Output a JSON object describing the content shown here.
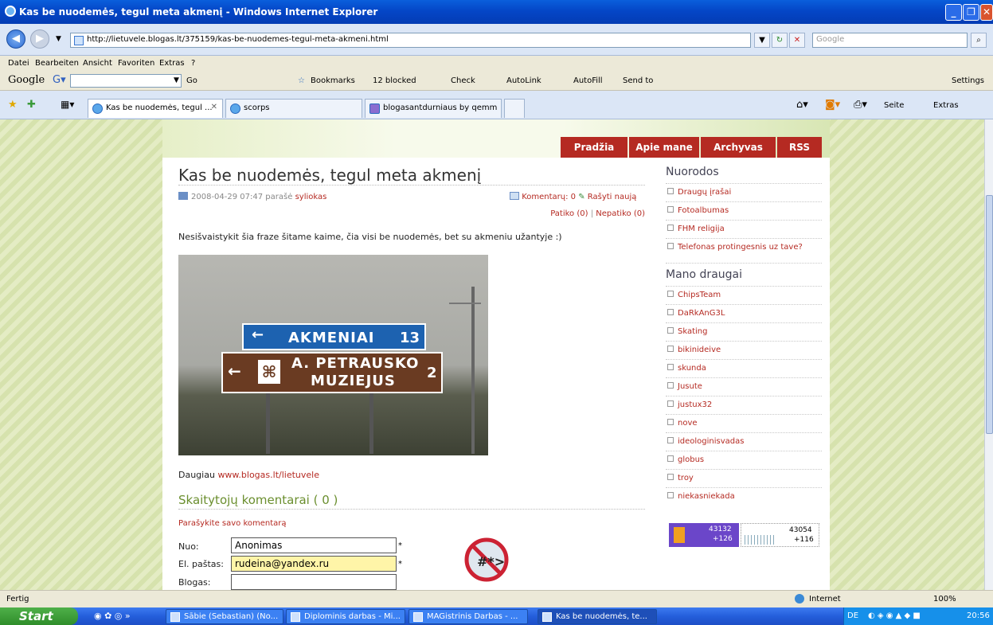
{
  "window": {
    "title": "Kas be nuodemės, tegul meta akmenį - Windows Internet Explorer"
  },
  "address": {
    "url": "http://lietuvele.blogas.lt/375159/kas-be-nuodemes-tegul-meta-akmeni.html",
    "search_placeholder": "Google"
  },
  "menu": [
    "Datei",
    "Bearbeiten",
    "Ansicht",
    "Favoriten",
    "Extras",
    "?"
  ],
  "google_toolbar": {
    "brand": "Google",
    "go": "Go",
    "bookmarks": "Bookmarks",
    "blocked": "12 blocked",
    "check": "Check",
    "autolink": "AutoLink",
    "autofill": "AutoFill",
    "sendto": "Send to",
    "settings": "Settings"
  },
  "tabs": [
    "Kas be nuodemės, tegul ...",
    "scorps",
    "blogasantdurniaus by qemm"
  ],
  "cmdbar": {
    "seite": "Seite",
    "extras": "Extras"
  },
  "blog": {
    "nav": [
      "Pradžia",
      "Apie mane",
      "Archyvas",
      "RSS"
    ],
    "post_title": "Kas be nuodemės, tegul meta akmenį",
    "meta_date": "2008-04-29 07:47 parašė",
    "meta_author": "syliokas",
    "comments_link": "Komentarų: 0",
    "write_new": "Rašyti naują",
    "likes": "Patiko (0)",
    "sep": "|",
    "dislikes": "Nepatiko (0)",
    "body": "Nesišvaistykit šia fraze šitame kaime, čia visi be nuodemės, bet su akmeniu užantyje :)",
    "sign1_text": "AKMENIAI",
    "sign1_num": "13",
    "sign2_line1": "A. PETRAUSKO",
    "sign2_line2": "MUZIEJUS",
    "sign2_num": "2",
    "more_label": "Daugiau",
    "more_link": "www.blogas.lt/lietuvele",
    "comments_heading": "Skaitytojų komentarai ( 0 )",
    "write_comment": "Parašykite savo komentarą",
    "form": {
      "from_label": "Nuo:",
      "from_value": "Anonimas",
      "email_label": "El. paštas:",
      "email_value": "rudeina@yandex.ru",
      "blog_label": "Blogas:",
      "blog_value": "",
      "required": "*"
    },
    "sidebar": {
      "links_heading": "Nuorodos",
      "links": [
        "Draugų įrašai",
        "Fotoalbumas",
        "FHM religija",
        "Telefonas protingesnis uz tave?"
      ],
      "friends_heading": "Mano draugai",
      "friends": [
        "ChipsTeam",
        "DaRkAnG3L",
        "Skating",
        "bikinideive",
        "skunda",
        "Jusute",
        "justux32",
        "nove",
        "ideologinisvadas",
        "globus",
        "troy",
        "niekasniekada"
      ],
      "counter1_a": "43132",
      "counter1_b": "+126",
      "counter2_a": "43054",
      "counter2_b": "+116"
    }
  },
  "status": {
    "text": "Fertig",
    "zone": "Internet",
    "zoom": "100%"
  },
  "taskbar": {
    "start": "Start",
    "tasks": [
      "Sābie (Sebastian) (No...",
      "Diplominis darbas - Mi...",
      "MAGistrinis Darbas - ...",
      "Kas be nuodemės, te..."
    ],
    "lang": "DE",
    "clock": "20:56"
  },
  "colors": {
    "accent": "#b52a22",
    "heading_green": "#6b8f2f",
    "xp_blue": "#245edb"
  }
}
